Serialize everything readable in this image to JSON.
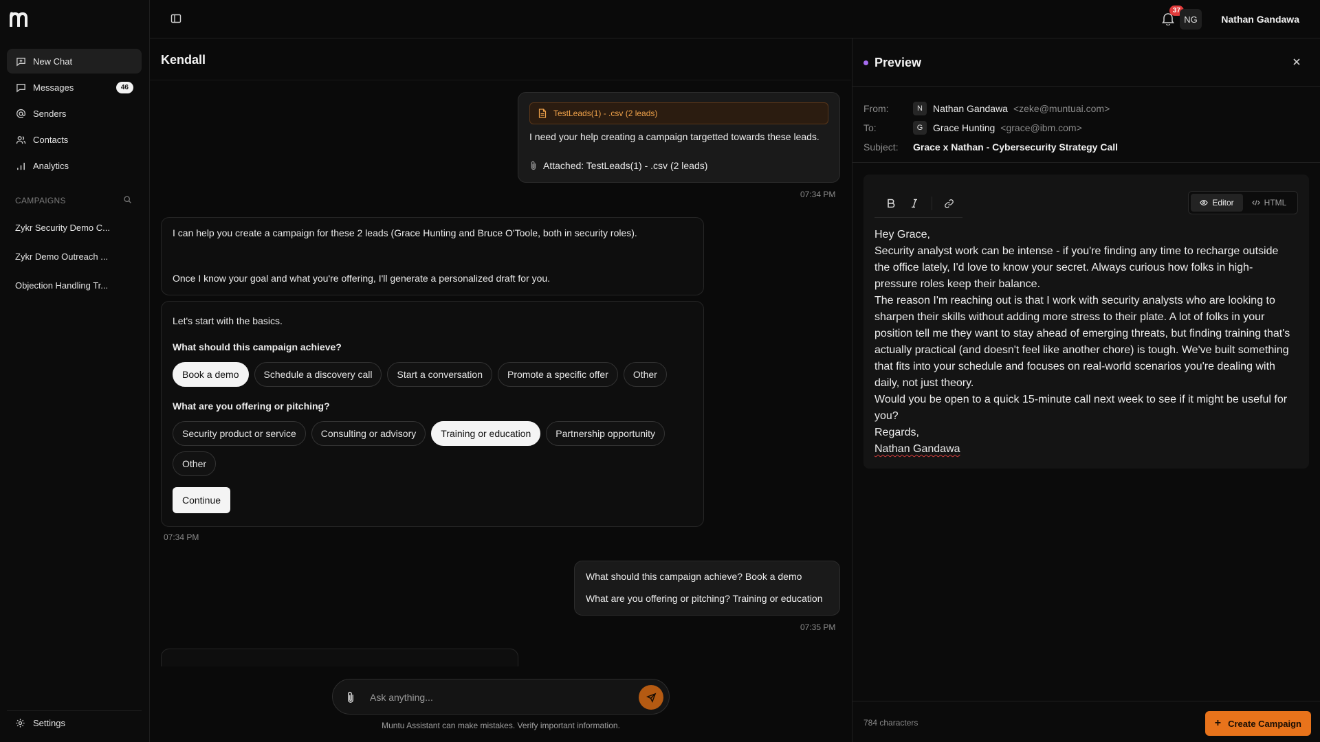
{
  "sidebar": {
    "nav": [
      {
        "label": "New Chat",
        "icon": "new-chat-icon",
        "active": true
      },
      {
        "label": "Messages",
        "icon": "message-icon",
        "count": "46"
      },
      {
        "label": "Senders",
        "icon": "at-sign-icon"
      },
      {
        "label": "Contacts",
        "icon": "contacts-icon"
      },
      {
        "label": "Analytics",
        "icon": "analytics-icon"
      }
    ],
    "campaigns_heading": "CAMPAIGNS",
    "campaigns": [
      "Zykr Security Demo C...",
      "Zykr Demo Outreach ...",
      "Objection Handling Tr..."
    ],
    "settings_label": "Settings"
  },
  "topbar": {
    "notification_count": "37",
    "avatar_initials": "NG",
    "user_name": "Nathan Gandawa"
  },
  "chat": {
    "title": "Kendall",
    "msg1": {
      "file_label": "TestLeads(1) - .csv (2 leads)",
      "text": "I need your help creating a campaign targetted towards these leads.",
      "attached": "Attached: TestLeads(1) - .csv (2 leads)",
      "time": "07:34 PM"
    },
    "msg2": {
      "line1": "I can help you create a campaign for these 2 leads (Grace Hunting and Bruce O'Toole, both in security roles).",
      "line2": "Once I know your goal and what you're offering, I'll generate a personalized draft for you."
    },
    "form": {
      "intro": "Let's start with the basics.",
      "q1": "What should this campaign achieve?",
      "q1_options": [
        "Book a demo",
        "Schedule a discovery call",
        "Start a conversation",
        "Promote a specific offer",
        "Other"
      ],
      "q2": "What are you offering or pitching?",
      "q2_options": [
        "Security product or service",
        "Consulting or advisory",
        "Training or education",
        "Partnership opportunity",
        "Other"
      ],
      "continue": "Continue",
      "time": "07:34 PM"
    },
    "msg3": {
      "line1": "What should this campaign achieve? Book a demo",
      "line2": "What are you offering or pitching? Training or education",
      "time": "07:35 PM"
    },
    "composer_placeholder": "Ask anything...",
    "disclaimer": "Muntu Assistant can make mistakes. Verify important information."
  },
  "preview": {
    "title": "Preview",
    "from_label": "From:",
    "from_initial": "N",
    "from_name": "Nathan Gandawa",
    "from_email": "<zeke@muntuai.com>",
    "to_label": "To:",
    "to_initial": "G",
    "to_name": "Grace Hunting",
    "to_email": "<grace@ibm.com>",
    "subject_label": "Subject:",
    "subject": "Grace x Nathan - Cybersecurity Strategy Call",
    "mode_editor": "Editor",
    "mode_html": "HTML",
    "body": [
      "Hey Grace,",
      "Security analyst work can be intense - if you're finding any time to recharge outside the office lately, I'd love to know your secret. Always curious how folks in high-pressure roles keep their balance.",
      "The reason I'm reaching out is that I work with security analysts who are looking to sharpen their skills without adding more stress to their plate. A lot of folks in your position tell me they want to stay ahead of emerging threats, but finding training that's actually practical (and doesn't feel like another chore) is tough. We've built something that fits into your schedule and focuses on real-world scenarios you're dealing with daily, not just theory.",
      "Would you be open to a quick 15-minute call next week to see if it might be useful for you?",
      "Regards,",
      "Nathan Gandawa"
    ],
    "char_count": "784 characters",
    "create_button": "Create Campaign"
  },
  "colors": {
    "accent": "#e8731b",
    "file_chip_text": "#f0a24a",
    "notification": "#e23b3b",
    "preview_dot": "#a66cf0"
  }
}
